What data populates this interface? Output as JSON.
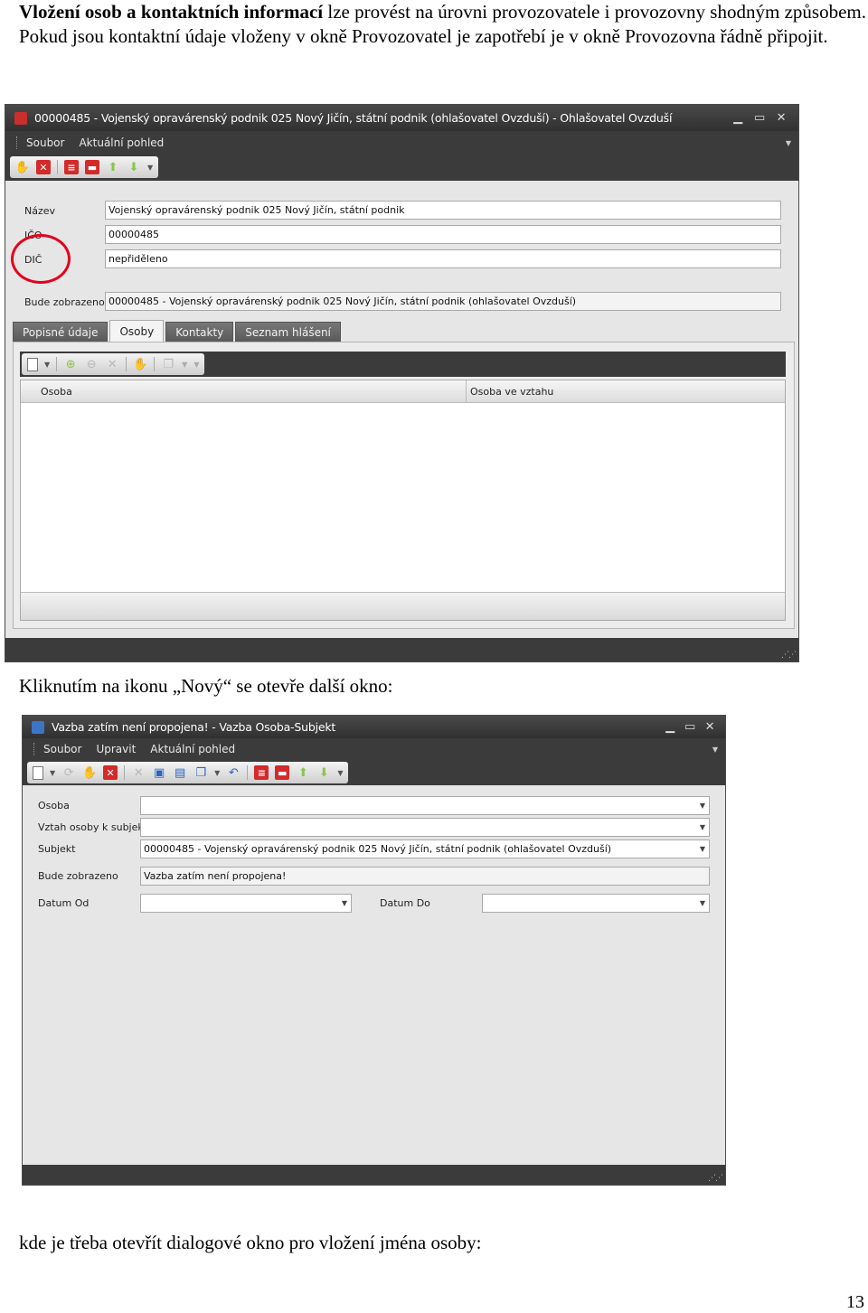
{
  "intro": {
    "bold": "Vložení osob a kontaktních informací",
    "rest": " lze provést na úrovni provozovatele i provozovny shodným způsobem. Pokud jsou kontaktní údaje vloženy v okně Provozovatel je zapotřebí je v okně Provozovna řádně připojit."
  },
  "window1": {
    "title": "00000485 - Vojenský opravárenský podnik 025 Nový Jičín, státní podnik (ohlašovatel Ovzduší) - Ohlašovatel Ovzduší",
    "menu": [
      "Soubor",
      "Aktuální pohled"
    ],
    "fields": {
      "nazev_label": "Název",
      "nazev_value": "Vojenský opravárenský podnik 025 Nový Jičín, státní podnik",
      "ico_label": "IČO",
      "ico_value": "00000485",
      "dic_label": "DIČ",
      "dic_value": "nepřiděleno",
      "display_label": "Bude zobrazeno",
      "display_value": "00000485 - Vojenský opravárenský podnik 025 Nový Jičín, státní podnik (ohlašovatel Ovzduší)"
    },
    "tabs": [
      "Popisné údaje",
      "Osoby",
      "Kontakty",
      "Seznam hlášení"
    ],
    "active_tab": "Osoby",
    "grid_columns": [
      "Osoba",
      "Osoba ve vztahu"
    ],
    "highlight_color": "#e4001b"
  },
  "caption2": "Kliknutím na ikonu „Nový“ se otevře další okno:",
  "window2": {
    "title": "Vazba zatím není propojena! - Vazba Osoba-Subjekt",
    "menu": [
      "Soubor",
      "Upravit",
      "Aktuální pohled"
    ],
    "fields": {
      "osoba_label": "Osoba",
      "osoba_value": "",
      "vztah_label": "Vztah osoby k subjektu",
      "vztah_value": "",
      "subjekt_label": "Subjekt",
      "subjekt_value": "00000485 - Vojenský opravárenský podnik 025 Nový Jičín, státní podnik (ohlašovatel Ovzduší)",
      "display_label": "Bude zobrazeno",
      "display_value": "Vazba zatím není propojena!",
      "datum_od_label": "Datum Od",
      "datum_od_value": "",
      "datum_do_label": "Datum Do",
      "datum_do_value": ""
    }
  },
  "caption3": "kde je třeba otevřít dialogové okno pro vložení jména osoby:",
  "page_number": "13"
}
